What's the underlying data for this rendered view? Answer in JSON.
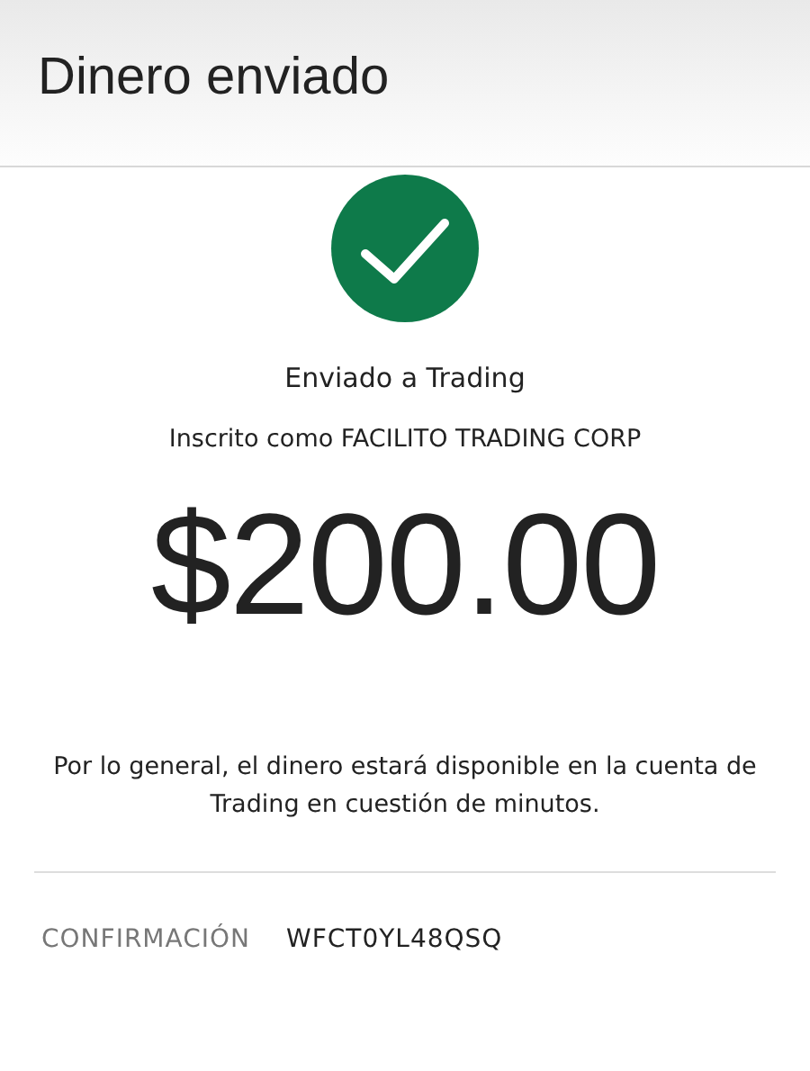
{
  "header": {
    "title": "Dinero enviado"
  },
  "status": {
    "kind": "success"
  },
  "recipient": "Enviado a Trading",
  "enrolled_as": "Inscrito como FACILITO TRADING CORP",
  "amount": "$200.00",
  "note": "Por lo general, el dinero estará disponible en la cuenta de Trading en cuestión de minutos.",
  "confirmation": {
    "label": "CONFIRMACIÓN",
    "value": "WFCT0YL48QSQ"
  }
}
